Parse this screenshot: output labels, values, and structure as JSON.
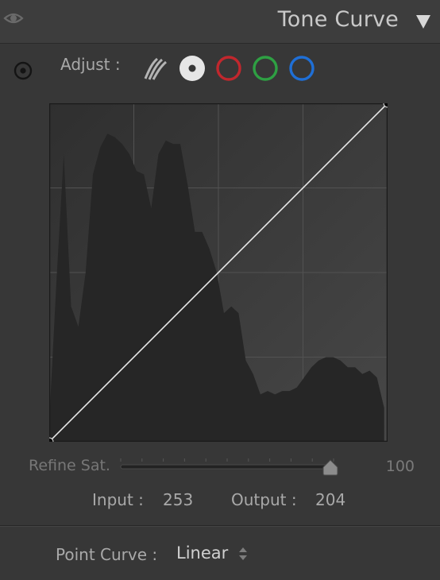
{
  "header": {
    "title": "Tone Curve",
    "visibility_icon": "eye-icon",
    "collapse_icon": "triangle-down-icon"
  },
  "adjust": {
    "label": "Adjust :",
    "targeted_tool_icon": "target-icon",
    "channels": [
      {
        "name": "parametric",
        "icon": "parametric-curve-icon",
        "color": "#b4b4b4"
      },
      {
        "name": "point",
        "icon": "point-curve-icon",
        "color": "#e6e6e6",
        "selected": true
      },
      {
        "name": "red",
        "icon": "red-channel-icon",
        "color": "#c1272d"
      },
      {
        "name": "green",
        "icon": "green-channel-icon",
        "color": "#2ea043"
      },
      {
        "name": "blue",
        "icon": "blue-channel-icon",
        "color": "#1f6fd6"
      }
    ]
  },
  "curve": {
    "grid_divisions": 4,
    "points": [
      [
        0,
        0
      ],
      [
        255,
        255
      ]
    ],
    "histogram": [
      6,
      48,
      85,
      40,
      34,
      50,
      79,
      87,
      91,
      90,
      88,
      85,
      80,
      79,
      69,
      85,
      89,
      88,
      88,
      76,
      62,
      62,
      57,
      50,
      38,
      40,
      38,
      24,
      20,
      14,
      15,
      14,
      15,
      15,
      16,
      19,
      22,
      24,
      25,
      25,
      24,
      22,
      22,
      20,
      21,
      19,
      10
    ]
  },
  "refine": {
    "label": "Refine Sat.",
    "value": "100",
    "level": 1.0
  },
  "readout": {
    "input_label": "Input :",
    "input_value": "253",
    "output_label": "Output :",
    "output_value": "204"
  },
  "point_curve": {
    "label": "Point Curve :",
    "value": "Linear"
  }
}
